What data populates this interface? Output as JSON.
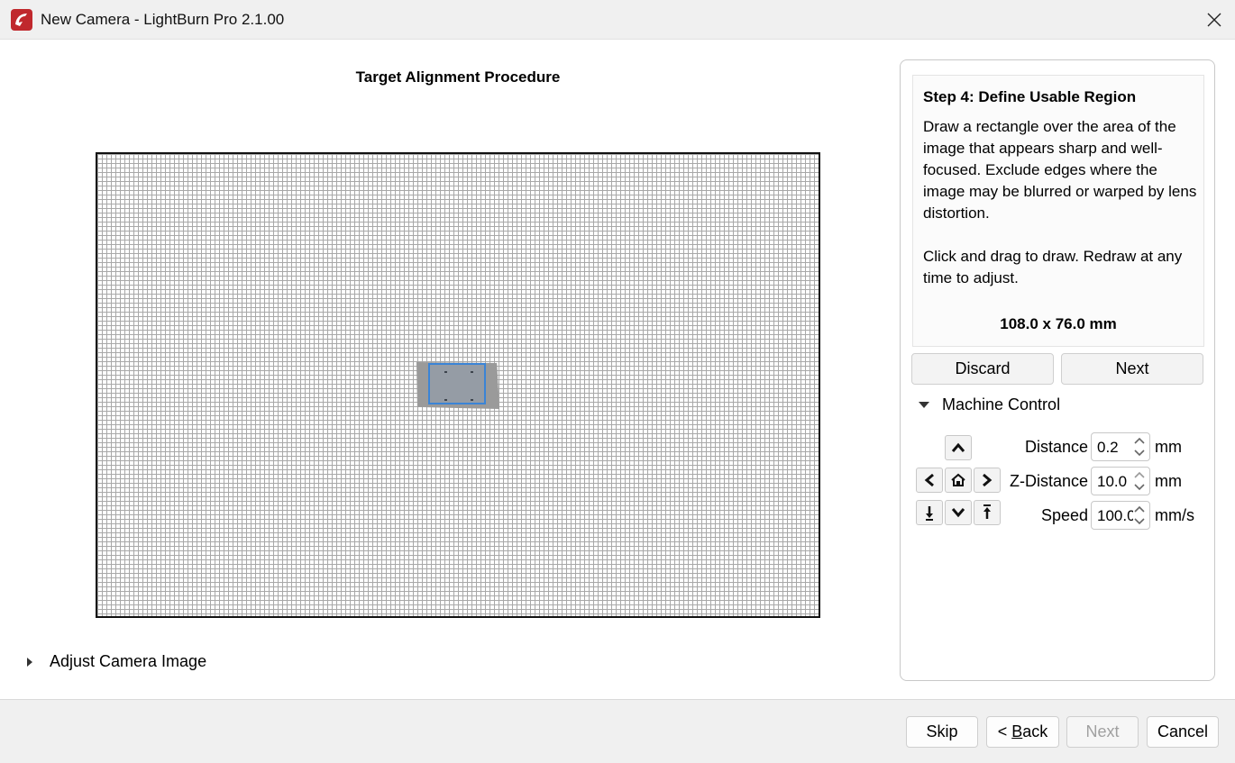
{
  "window": {
    "title": "New Camera - LightBurn Pro 2.1.00",
    "icon": "lightburn-app-icon",
    "close_icon": "close-icon"
  },
  "main": {
    "procedure_title": "Target Alignment Procedure",
    "adjust_camera_label": "Adjust Camera Image"
  },
  "step": {
    "title": "Step 4: Define Usable Region",
    "description": "Draw a rectangle over the area of the image that appears sharp and well-focused. Exclude edges where the image may be blurred or warped by lens distortion.",
    "instruction": "Click and drag to draw. Redraw at any time to adjust.",
    "dimensions": "108.0 x 76.0 mm"
  },
  "actions": {
    "discard": "Discard",
    "next": "Next"
  },
  "machine_control": {
    "label": "Machine Control",
    "distance": {
      "label": "Distance",
      "value": "0.2",
      "unit": "mm"
    },
    "z_distance": {
      "label": "Z-Distance",
      "value": "10.0",
      "unit": "mm"
    },
    "speed": {
      "label": "Speed",
      "value": "100.0",
      "unit": "mm/s"
    },
    "jog_icons": [
      "chevron-up-icon",
      "chevron-left-icon",
      "home-icon",
      "chevron-right-icon",
      "z-down-icon",
      "chevron-down-icon",
      "z-up-icon"
    ]
  },
  "footer": {
    "skip": "Skip",
    "back_prefix": "< ",
    "back_mnemonic": "B",
    "back_rest": "ack",
    "next": "Next",
    "cancel": "Cancel"
  },
  "colors": {
    "accent_rect": "#3b84d6",
    "brand_red": "#c0282d"
  }
}
